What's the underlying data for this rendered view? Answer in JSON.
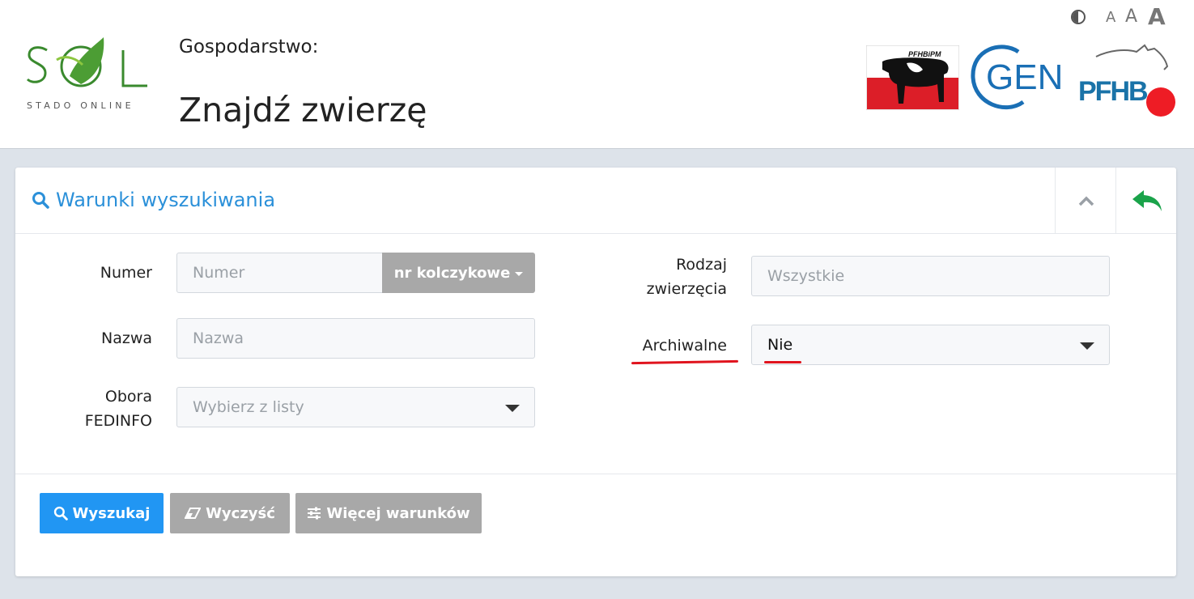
{
  "header": {
    "logo_text": "SOL",
    "logo_subtitle": "STADO ONLINE",
    "farm_label": "Gospodarstwo:",
    "page_title": "Znajdź zwierzę",
    "font_size_labels": [
      "A",
      "A",
      "A"
    ],
    "partner_logos": [
      {
        "name": "PFHBiPM",
        "text": "PFHBiPM"
      },
      {
        "name": "CGen",
        "text": "GEN"
      },
      {
        "name": "PFHB",
        "text": "PFHB"
      }
    ]
  },
  "panel": {
    "title": "Warunki wyszukiwania",
    "collapse_icon": "chevron-up-icon",
    "back_icon": "reply-arrow-icon"
  },
  "form": {
    "numer": {
      "label": "Numer",
      "placeholder": "Numer",
      "addon_label": "nr kolczykowe"
    },
    "nazwa": {
      "label": "Nazwa",
      "placeholder": "Nazwa"
    },
    "obora": {
      "label_line1": "Obora",
      "label_line2": "FEDINFO",
      "placeholder": "Wybierz z listy"
    },
    "rodzaj": {
      "label_line1": "Rodzaj",
      "label_line2": "zwierzęcia",
      "placeholder": "Wszystkie"
    },
    "archiwalne": {
      "label": "Archiwalne",
      "value": "Nie"
    }
  },
  "actions": {
    "search_label": "Wyszukaj",
    "clear_label": "Wyczyść",
    "more_label": "Więcej warunków"
  },
  "colors": {
    "primary": "#2196f3",
    "secondary": "#a8a8a8",
    "accent_green": "#1aa34a",
    "annotation_red": "#e0141e"
  }
}
